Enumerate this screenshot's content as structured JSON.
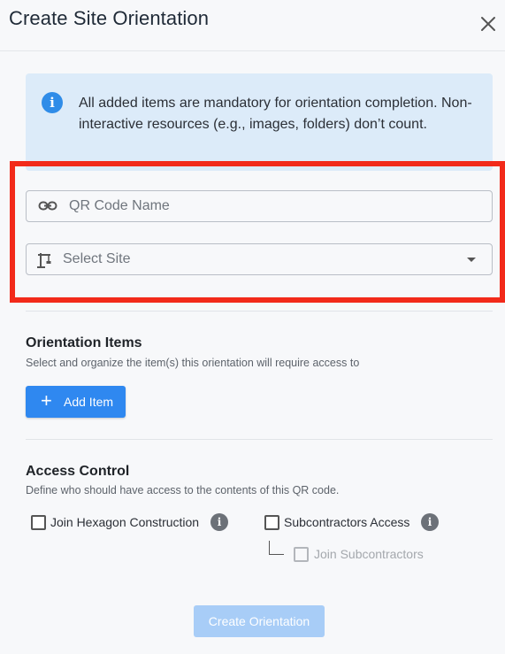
{
  "dialog": {
    "title": "Create Site Orientation",
    "close_icon": "close-icon"
  },
  "info": {
    "icon": "info-icon",
    "text": "All added items are mandatory for orientation completion. Non-interactive resources (e.g., images, folders) don’t count."
  },
  "form": {
    "qr_code_name": {
      "placeholder": "QR Code Name",
      "value": "",
      "icon": "link-icon"
    },
    "site_select": {
      "placeholder": "Select Site",
      "icon": "crane-icon"
    }
  },
  "orientation_items": {
    "title": "Orientation Items",
    "subtitle": "Select and organize the item(s) this orientation will require access to",
    "add_button_label": "Add Item"
  },
  "access_control": {
    "title": "Access Control",
    "subtitle": "Define who should have access to the contents of this QR code.",
    "options": [
      {
        "label": "Join Hexagon Construction",
        "checked": false
      },
      {
        "label": "Subcontractors Access",
        "checked": false
      },
      {
        "label": "Join Subcontractors",
        "checked": false,
        "disabled": true
      }
    ]
  },
  "footer": {
    "create_button_label": "Create Orientation"
  },
  "colors": {
    "primary": "#2f88f0",
    "info_bg": "#dcebf9",
    "highlight": "#f22a1a",
    "disabled_button": "#a8cdf7"
  }
}
